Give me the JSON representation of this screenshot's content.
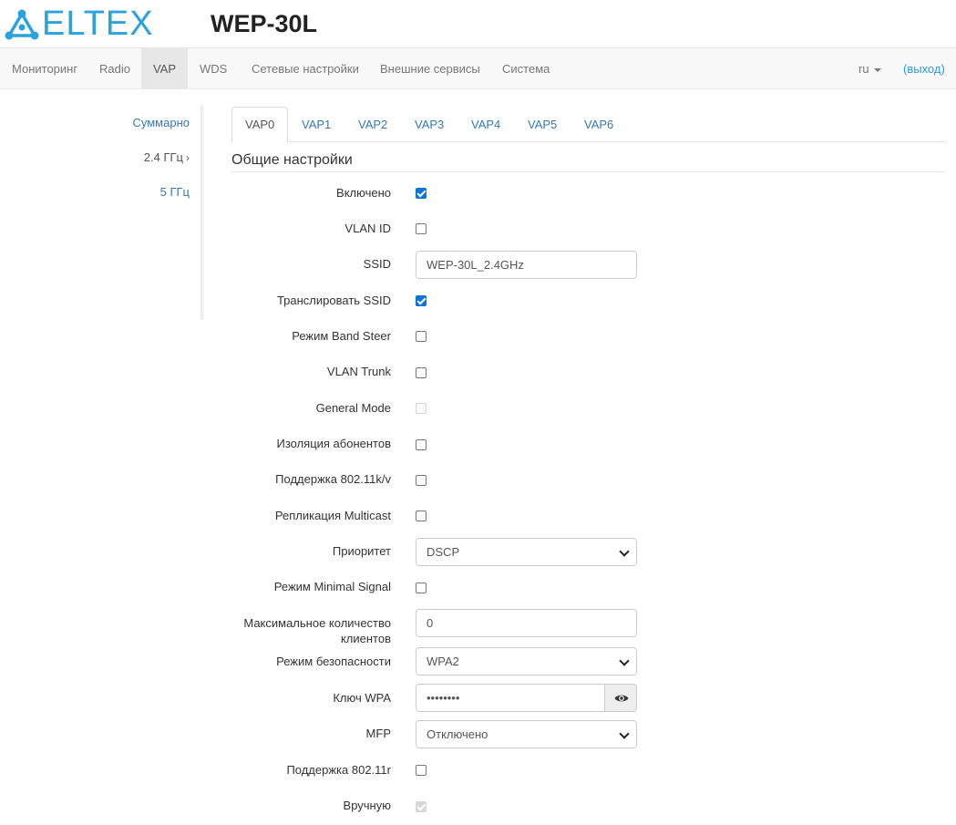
{
  "brand": {
    "logo_text": "ELTEX",
    "product": "WEP-30L",
    "accent": "#2aa2dc"
  },
  "nav": {
    "items": [
      "Мониторинг",
      "Radio",
      "VAP",
      "WDS",
      "Сетевые настройки",
      "Внешние сервисы",
      "Система"
    ],
    "active": "VAP",
    "lang": "ru",
    "logout": "(выход)"
  },
  "sidebar": {
    "items": [
      "Суммарно",
      "2.4 ГГц",
      "5 ГГц"
    ],
    "current": "2.4 ГГц",
    "chevron": "›"
  },
  "tabs": {
    "items": [
      "VAP0",
      "VAP1",
      "VAP2",
      "VAP3",
      "VAP4",
      "VAP5",
      "VAP6"
    ],
    "active": "VAP0"
  },
  "section": {
    "title": "Общие настройки"
  },
  "form": {
    "enabled": {
      "label": "Включено",
      "checked": true
    },
    "vlan_id": {
      "label": "VLAN ID",
      "checked": false
    },
    "ssid": {
      "label": "SSID",
      "value": "WEP-30L_2.4GHz"
    },
    "broadcast_ssid": {
      "label": "Транслировать SSID",
      "checked": true
    },
    "band_steer": {
      "label": "Режим Band Steer",
      "checked": false
    },
    "vlan_trunk": {
      "label": "VLAN Trunk",
      "checked": false
    },
    "general_mode": {
      "label": "General Mode",
      "checked": false,
      "disabled": true
    },
    "client_isolation": {
      "label": "Изоляция абонентов",
      "checked": false
    },
    "support_80211kv": {
      "label": "Поддержка 802.11k/v",
      "checked": false
    },
    "multicast_replication": {
      "label": "Репликация Multicast",
      "checked": false
    },
    "priority": {
      "label": "Приоритет",
      "value": "DSCP"
    },
    "minimal_signal": {
      "label": "Режим Minimal Signal",
      "checked": false
    },
    "max_clients": {
      "label_line1": "Максимальное количество",
      "label_line2": "клиентов",
      "value": "0"
    },
    "security_mode": {
      "label": "Режим безопасности",
      "value": "WPA2"
    },
    "wpa_key": {
      "label": "Ключ WPA",
      "value": "••••••••"
    },
    "mfp": {
      "label": "MFP",
      "value": "Отключено"
    },
    "support_80211r": {
      "label": "Поддержка 802.11r",
      "checked": false
    },
    "manual": {
      "label": "Вручную",
      "checked": true,
      "disabled": true
    }
  }
}
